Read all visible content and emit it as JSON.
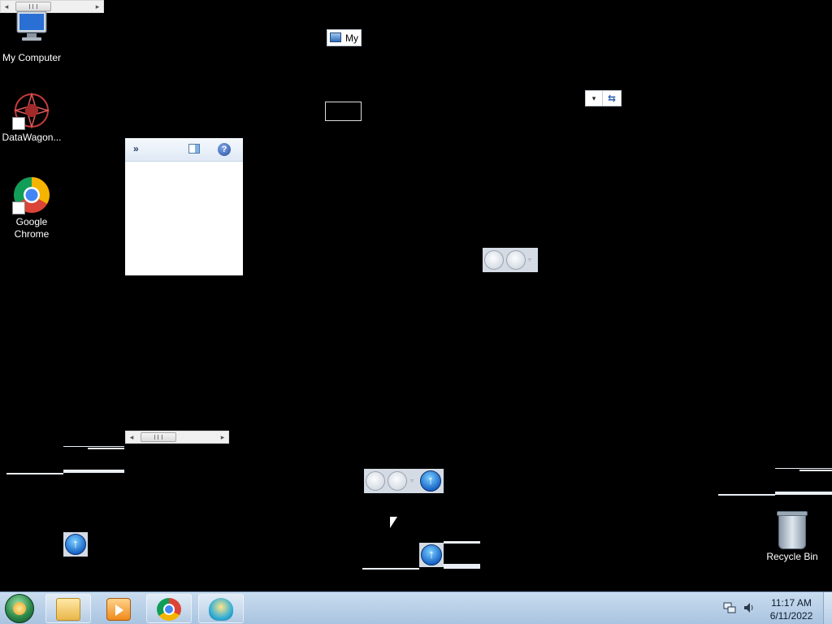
{
  "desktop": {
    "icons": [
      {
        "label": "My Computer",
        "icon": "computer-icon"
      },
      {
        "label": "DataWagon...",
        "icon": "datawagon-icon"
      },
      {
        "label": "Google Chrome",
        "icon": "chrome-icon"
      },
      {
        "label": "Recycle Bin",
        "icon": "recycle-bin-icon"
      }
    ]
  },
  "fragments": {
    "my_button_label": "My",
    "help_glyph": "?",
    "chevron_glyph": "»",
    "up_glyph": "↑",
    "dropdown_glyph": "▾",
    "refresh_glyph": "⇆",
    "nav_dropdown_glyph": "▿"
  },
  "scrollbars": {
    "left_arrow": "◂",
    "right_arrow": "▸"
  },
  "taskbar": {
    "buttons": [
      {
        "name": "file-explorer",
        "icon": "folder-icon"
      },
      {
        "name": "media-player",
        "icon": "media-player-icon"
      },
      {
        "name": "google-chrome",
        "icon": "chrome-icon"
      },
      {
        "name": "app-shell",
        "icon": "shell-icon"
      }
    ],
    "clock": {
      "time": "11:17 AM",
      "date": "6/11/2022"
    }
  },
  "colors": {
    "desktop_background": "#000000",
    "taskbar": "#b9d0e8",
    "accent": "#1a66c9"
  }
}
